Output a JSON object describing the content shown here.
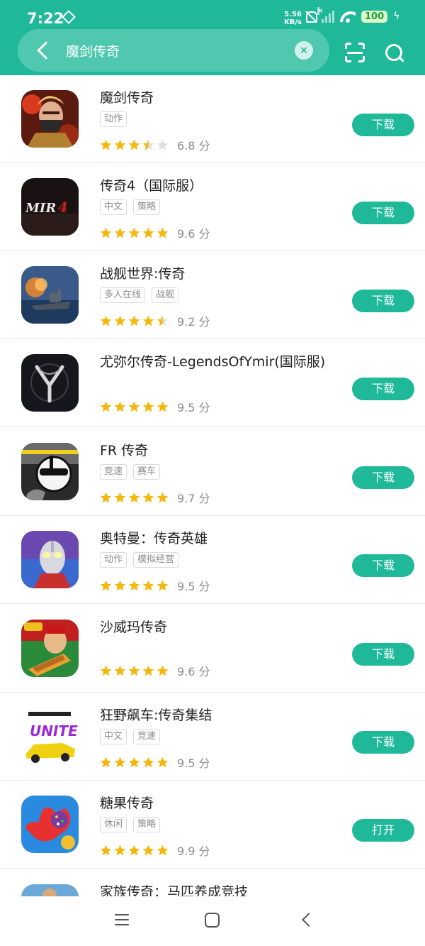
{
  "status_bar": {
    "time": "7:22",
    "speed_value": "5.56",
    "speed_unit": "KB/s",
    "battery": "100"
  },
  "search": {
    "query": "魔剑传奇"
  },
  "colors": {
    "accent": "#1fb99a",
    "star": "#f6b80c",
    "star_empty": "#e0e0e0"
  },
  "apps": [
    {
      "title": "魔剑传奇",
      "tags": [
        "动作"
      ],
      "rating": 3.5,
      "score": "6.8 分",
      "action": "下载",
      "icon": "warrior-game-icon"
    },
    {
      "title": "传奇4（国际服）",
      "tags": [
        "中文",
        "策略"
      ],
      "rating": 5,
      "score": "9.6 分",
      "action": "下载",
      "icon": "mir4-game-icon"
    },
    {
      "title": "战舰世界:传奇",
      "tags": [
        "多人在线",
        "战舰"
      ],
      "rating": 4.5,
      "score": "9.2 分",
      "action": "下载",
      "icon": "warship-game-icon"
    },
    {
      "title": "尤弥尔传奇-LegendsOfYmir(国际服)",
      "tags": [],
      "rating": 5,
      "score": "9.5 分",
      "action": "下载",
      "icon": "ymir-game-icon"
    },
    {
      "title": "FR 传奇",
      "tags": [
        "竞速",
        "赛车"
      ],
      "rating": 5,
      "score": "9.7 分",
      "action": "下载",
      "icon": "racer-helmet-game-icon"
    },
    {
      "title": "奥特曼：传奇英雄",
      "tags": [
        "动作",
        "模拟经营"
      ],
      "rating": 5,
      "score": "9.5 分",
      "action": "下载",
      "icon": "ultraman-game-icon"
    },
    {
      "title": "沙威玛传奇",
      "tags": [],
      "rating": 5,
      "score": "9.6 分",
      "action": "下载",
      "icon": "shawarma-game-icon"
    },
    {
      "title": "狂野飙车:传奇集结",
      "tags": [
        "中文",
        "竞速"
      ],
      "rating": 5,
      "score": "9.5 分",
      "action": "下载",
      "icon": "asphalt-game-icon"
    },
    {
      "title": "糖果传奇",
      "tags": [
        "休闲",
        "策略"
      ],
      "rating": 5,
      "score": "9.9 分",
      "action": "打开",
      "icon": "candy-game-icon"
    },
    {
      "title": "家族传奇：马匹养成竞技",
      "tags": [],
      "rating": 0,
      "score": "",
      "action": "",
      "icon": "family-game-icon"
    }
  ]
}
